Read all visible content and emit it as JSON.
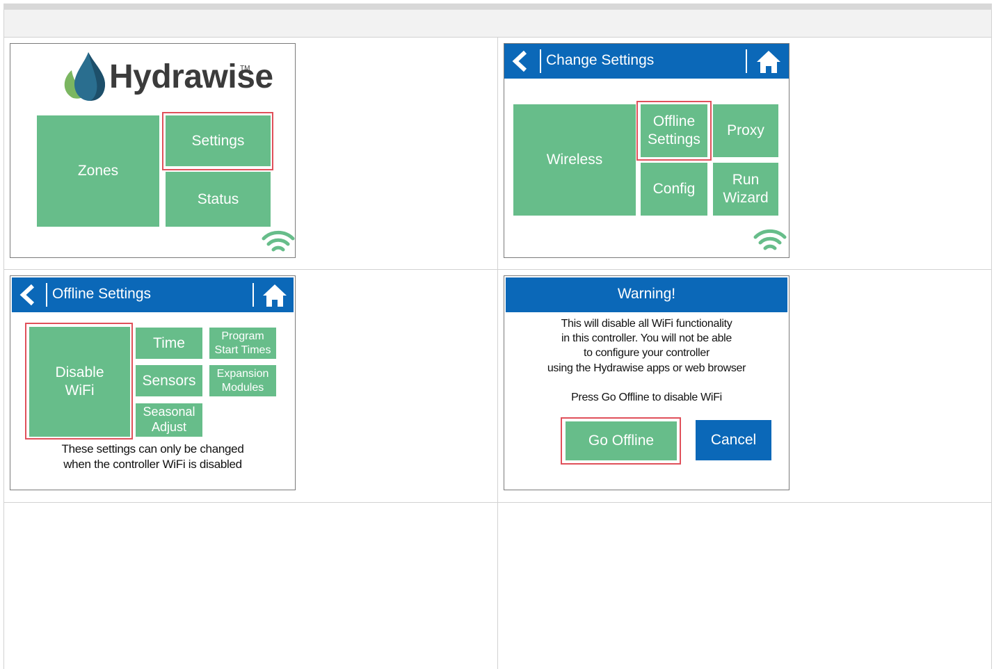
{
  "panel1": {
    "brand": "Hydrawise",
    "trademark": "TM",
    "zones": "Zones",
    "settings": "Settings",
    "status": "Status"
  },
  "panel2": {
    "title": "Change Settings",
    "wireless": "Wireless",
    "offline_settings": "Offline\nSettings",
    "proxy": "Proxy",
    "config": "Config",
    "run_wizard": "Run\nWizard"
  },
  "panel3": {
    "title": "Offline Settings",
    "disable_wifi": "Disable\nWiFi",
    "time": "Time",
    "program_start_times": "Program\nStart Times",
    "sensors": "Sensors",
    "expansion_modules": "Expansion\nModules",
    "seasonal_adjust": "Seasonal\nAdjust",
    "note_line1": "These settings can only be changed",
    "note_line2": "when the controller WiFi is disabled"
  },
  "panel4": {
    "title": "Warning!",
    "msg_line1": "This will disable all WiFi functionality",
    "msg_line2": "in this controller. You will not be able",
    "msg_line3": "to configure your controller",
    "msg_line4": "using the Hydrawise apps or web browser",
    "msg_line5": "Press Go Offline to disable WiFi",
    "go_offline": "Go Offline",
    "cancel": "Cancel"
  },
  "colors": {
    "tile_green": "#67bd8a",
    "title_blue": "#0b68b8",
    "highlight_red": "#e0505a"
  },
  "icons": [
    "back-chevron-icon",
    "home-icon",
    "wifi-signal-icon",
    "water-drop-leaf-logo"
  ]
}
